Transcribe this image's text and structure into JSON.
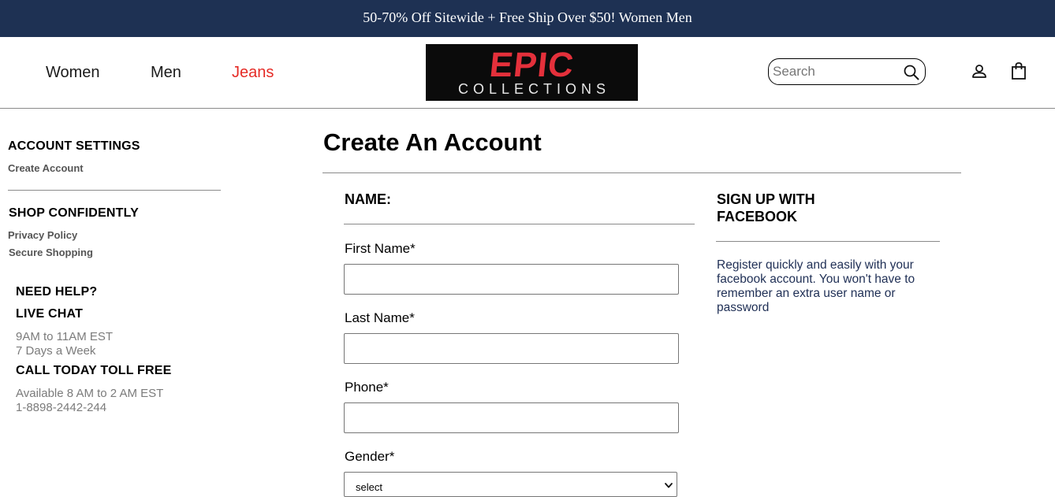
{
  "promo": {
    "text": "50-70% Off Sitewide + Free Ship Over $50! Women Men"
  },
  "nav": {
    "items": [
      {
        "label": "Women",
        "color": "#1a1a1a"
      },
      {
        "label": "Men",
        "color": "#1a1a1a"
      },
      {
        "label": "Jeans",
        "color": "#e52b26"
      }
    ]
  },
  "logo": {
    "line1": "EPIC",
    "line2": "COLLECTIONS"
  },
  "search": {
    "placeholder": "Search",
    "value": ""
  },
  "icons": {
    "search": "search-icon",
    "user": "user-icon",
    "cart": "shopping-bag-icon",
    "select": "chevron-down-icon"
  },
  "sidebar": {
    "account_heading": "ACCOUNT SETTINGS",
    "account_links": [
      "Create Account"
    ],
    "shop_heading": "SHOP CONFIDENTLY",
    "shop_links": [
      "Privacy Policy",
      "Secure Shopping"
    ],
    "help": {
      "heading": "NEED HELP?",
      "chat_heading": "LIVE CHAT",
      "chat_hours": "9AM to 11AM EST",
      "chat_days": "7 Days a Week",
      "call_heading": "CALL TODAY TOLL FREE",
      "call_hours": "Available 8 AM to 2 AM EST",
      "phone": "1-8898-2442-244"
    }
  },
  "main": {
    "title": "Create An Account",
    "name_heading": "NAME:",
    "fields": {
      "first_name": {
        "label": "First Name*",
        "value": ""
      },
      "last_name": {
        "label": "Last Name*",
        "value": ""
      },
      "phone": {
        "label": "Phone*",
        "value": ""
      },
      "gender": {
        "label": "Gender*",
        "selected": "select"
      }
    }
  },
  "facebook": {
    "heading_line1": "SIGN UP WITH",
    "heading_line2": "FACEBOOK",
    "description": "Register quickly and easily with your facebook account. You won't have to remember an extra user name or password"
  },
  "colors": {
    "promo_bg": "#1e3153",
    "accent": "#e52b26",
    "logo_bg": "#0b0b0b",
    "fb_text": "#1f2f55"
  }
}
